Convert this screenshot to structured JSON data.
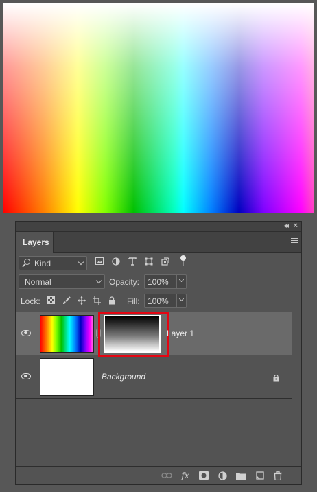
{
  "panel": {
    "tab_label": "Layers",
    "filter": {
      "kind_label": "Kind"
    },
    "blend_mode": "Normal",
    "opacity_label": "Opacity:",
    "opacity_value": "100%",
    "lock_label": "Lock:",
    "fill_label": "Fill:",
    "fill_value": "100%"
  },
  "layers": [
    {
      "name": "Layer 1",
      "selected": true,
      "visible": true,
      "has_mask": true
    },
    {
      "name": "Background",
      "selected": false,
      "visible": true,
      "locked": true
    }
  ],
  "icons": {
    "filter": [
      "image-filter-icon",
      "adjustment-filter-icon",
      "type-filter-icon",
      "shape-filter-icon",
      "smart-object-filter-icon"
    ],
    "lock": [
      "lock-transparency-icon",
      "lock-paint-icon",
      "lock-position-icon",
      "lock-artboard-icon",
      "lock-all-icon"
    ],
    "bottom": [
      "link-layers-icon",
      "fx-icon",
      "add-mask-icon",
      "adjustment-layer-icon",
      "group-folder-icon",
      "new-layer-icon",
      "delete-icon"
    ]
  },
  "colors": {
    "panel_bg": "#535353",
    "selected_row": "#6a6a6a",
    "highlight": "#e30613"
  }
}
